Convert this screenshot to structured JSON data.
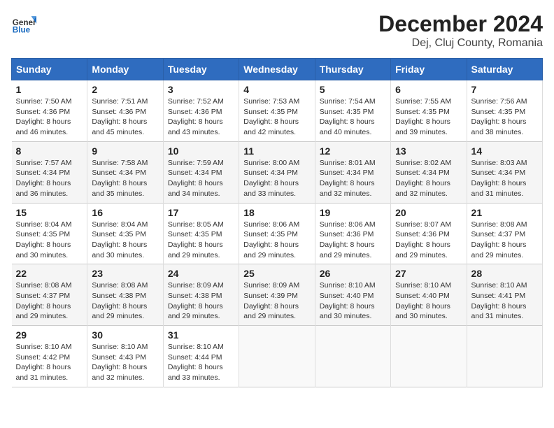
{
  "header": {
    "logo_general": "General",
    "logo_blue": "Blue",
    "title": "December 2024",
    "subtitle": "Dej, Cluj County, Romania"
  },
  "days_of_week": [
    "Sunday",
    "Monday",
    "Tuesday",
    "Wednesday",
    "Thursday",
    "Friday",
    "Saturday"
  ],
  "weeks": [
    [
      {
        "day": "1",
        "sunrise": "Sunrise: 7:50 AM",
        "sunset": "Sunset: 4:36 PM",
        "daylight": "Daylight: 8 hours and 46 minutes."
      },
      {
        "day": "2",
        "sunrise": "Sunrise: 7:51 AM",
        "sunset": "Sunset: 4:36 PM",
        "daylight": "Daylight: 8 hours and 45 minutes."
      },
      {
        "day": "3",
        "sunrise": "Sunrise: 7:52 AM",
        "sunset": "Sunset: 4:36 PM",
        "daylight": "Daylight: 8 hours and 43 minutes."
      },
      {
        "day": "4",
        "sunrise": "Sunrise: 7:53 AM",
        "sunset": "Sunset: 4:35 PM",
        "daylight": "Daylight: 8 hours and 42 minutes."
      },
      {
        "day": "5",
        "sunrise": "Sunrise: 7:54 AM",
        "sunset": "Sunset: 4:35 PM",
        "daylight": "Daylight: 8 hours and 40 minutes."
      },
      {
        "day": "6",
        "sunrise": "Sunrise: 7:55 AM",
        "sunset": "Sunset: 4:35 PM",
        "daylight": "Daylight: 8 hours and 39 minutes."
      },
      {
        "day": "7",
        "sunrise": "Sunrise: 7:56 AM",
        "sunset": "Sunset: 4:35 PM",
        "daylight": "Daylight: 8 hours and 38 minutes."
      }
    ],
    [
      {
        "day": "8",
        "sunrise": "Sunrise: 7:57 AM",
        "sunset": "Sunset: 4:34 PM",
        "daylight": "Daylight: 8 hours and 36 minutes."
      },
      {
        "day": "9",
        "sunrise": "Sunrise: 7:58 AM",
        "sunset": "Sunset: 4:34 PM",
        "daylight": "Daylight: 8 hours and 35 minutes."
      },
      {
        "day": "10",
        "sunrise": "Sunrise: 7:59 AM",
        "sunset": "Sunset: 4:34 PM",
        "daylight": "Daylight: 8 hours and 34 minutes."
      },
      {
        "day": "11",
        "sunrise": "Sunrise: 8:00 AM",
        "sunset": "Sunset: 4:34 PM",
        "daylight": "Daylight: 8 hours and 33 minutes."
      },
      {
        "day": "12",
        "sunrise": "Sunrise: 8:01 AM",
        "sunset": "Sunset: 4:34 PM",
        "daylight": "Daylight: 8 hours and 32 minutes."
      },
      {
        "day": "13",
        "sunrise": "Sunrise: 8:02 AM",
        "sunset": "Sunset: 4:34 PM",
        "daylight": "Daylight: 8 hours and 32 minutes."
      },
      {
        "day": "14",
        "sunrise": "Sunrise: 8:03 AM",
        "sunset": "Sunset: 4:34 PM",
        "daylight": "Daylight: 8 hours and 31 minutes."
      }
    ],
    [
      {
        "day": "15",
        "sunrise": "Sunrise: 8:04 AM",
        "sunset": "Sunset: 4:35 PM",
        "daylight": "Daylight: 8 hours and 30 minutes."
      },
      {
        "day": "16",
        "sunrise": "Sunrise: 8:04 AM",
        "sunset": "Sunset: 4:35 PM",
        "daylight": "Daylight: 8 hours and 30 minutes."
      },
      {
        "day": "17",
        "sunrise": "Sunrise: 8:05 AM",
        "sunset": "Sunset: 4:35 PM",
        "daylight": "Daylight: 8 hours and 29 minutes."
      },
      {
        "day": "18",
        "sunrise": "Sunrise: 8:06 AM",
        "sunset": "Sunset: 4:35 PM",
        "daylight": "Daylight: 8 hours and 29 minutes."
      },
      {
        "day": "19",
        "sunrise": "Sunrise: 8:06 AM",
        "sunset": "Sunset: 4:36 PM",
        "daylight": "Daylight: 8 hours and 29 minutes."
      },
      {
        "day": "20",
        "sunrise": "Sunrise: 8:07 AM",
        "sunset": "Sunset: 4:36 PM",
        "daylight": "Daylight: 8 hours and 29 minutes."
      },
      {
        "day": "21",
        "sunrise": "Sunrise: 8:08 AM",
        "sunset": "Sunset: 4:37 PM",
        "daylight": "Daylight: 8 hours and 29 minutes."
      }
    ],
    [
      {
        "day": "22",
        "sunrise": "Sunrise: 8:08 AM",
        "sunset": "Sunset: 4:37 PM",
        "daylight": "Daylight: 8 hours and 29 minutes."
      },
      {
        "day": "23",
        "sunrise": "Sunrise: 8:08 AM",
        "sunset": "Sunset: 4:38 PM",
        "daylight": "Daylight: 8 hours and 29 minutes."
      },
      {
        "day": "24",
        "sunrise": "Sunrise: 8:09 AM",
        "sunset": "Sunset: 4:38 PM",
        "daylight": "Daylight: 8 hours and 29 minutes."
      },
      {
        "day": "25",
        "sunrise": "Sunrise: 8:09 AM",
        "sunset": "Sunset: 4:39 PM",
        "daylight": "Daylight: 8 hours and 29 minutes."
      },
      {
        "day": "26",
        "sunrise": "Sunrise: 8:10 AM",
        "sunset": "Sunset: 4:40 PM",
        "daylight": "Daylight: 8 hours and 30 minutes."
      },
      {
        "day": "27",
        "sunrise": "Sunrise: 8:10 AM",
        "sunset": "Sunset: 4:40 PM",
        "daylight": "Daylight: 8 hours and 30 minutes."
      },
      {
        "day": "28",
        "sunrise": "Sunrise: 8:10 AM",
        "sunset": "Sunset: 4:41 PM",
        "daylight": "Daylight: 8 hours and 31 minutes."
      }
    ],
    [
      {
        "day": "29",
        "sunrise": "Sunrise: 8:10 AM",
        "sunset": "Sunset: 4:42 PM",
        "daylight": "Daylight: 8 hours and 31 minutes."
      },
      {
        "day": "30",
        "sunrise": "Sunrise: 8:10 AM",
        "sunset": "Sunset: 4:43 PM",
        "daylight": "Daylight: 8 hours and 32 minutes."
      },
      {
        "day": "31",
        "sunrise": "Sunrise: 8:10 AM",
        "sunset": "Sunset: 4:44 PM",
        "daylight": "Daylight: 8 hours and 33 minutes."
      },
      null,
      null,
      null,
      null
    ]
  ]
}
